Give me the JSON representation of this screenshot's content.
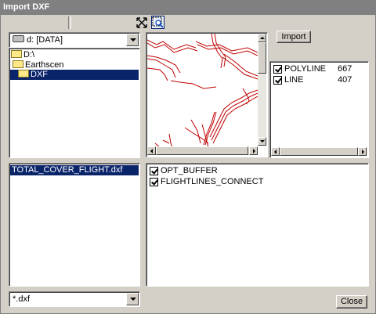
{
  "window": {
    "title": "Import DXF"
  },
  "toolbar": {
    "zoom_extents_icon": "zoom-extents-icon",
    "zoom_window_icon": "zoom-window-icon"
  },
  "drive_combo": {
    "value": "d: [DATA]"
  },
  "folder_tree": {
    "items": [
      {
        "label": "D:\\",
        "selected": false
      },
      {
        "label": "Earthscen",
        "selected": false
      },
      {
        "label": "DXF",
        "selected": true
      }
    ]
  },
  "import_button": {
    "label": "Import"
  },
  "entity_types": [
    {
      "name": "POLYLINE",
      "count": "667",
      "checked": true
    },
    {
      "name": "LINE",
      "count": "407",
      "checked": true
    }
  ],
  "files": [
    {
      "name": "TOTAL_COVER_FLIGHT.dxf",
      "selected": true
    }
  ],
  "layers": [
    {
      "name": "OPT_BUFFER",
      "checked": true
    },
    {
      "name": "FLIGHTLINES_CONNECT",
      "checked": true
    }
  ],
  "filter_combo": {
    "value": "*.dxf"
  },
  "close_button": {
    "label": "Close"
  },
  "colors": {
    "title_bar": "#808080",
    "selection": "#0a246a",
    "preview_lines": "#c00000"
  }
}
